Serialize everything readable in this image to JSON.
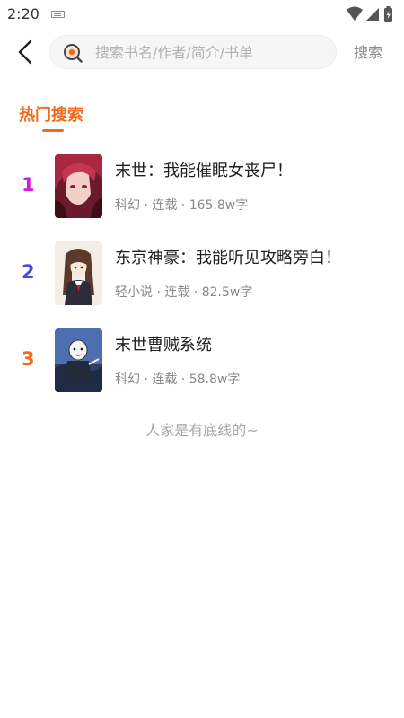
{
  "status_bar": {
    "time": "2:20",
    "icons": [
      "keyboard-icon",
      "wifi-icon",
      "signal-icon",
      "battery-charging-icon"
    ]
  },
  "search": {
    "placeholder": "搜索书名/作者/简介/书单",
    "value": "",
    "button_label": "搜索"
  },
  "hot_search": {
    "title": "热门搜索",
    "accent_color": "#f26b1d",
    "books": [
      {
        "rank": "1",
        "rank_color": "#d31ce0",
        "title": "末世：我能催眠女丧尸！",
        "meta": "科幻 · 连载 · 165.8w字"
      },
      {
        "rank": "2",
        "rank_color": "#4a4ad8",
        "title": "东京神豪：我能听见攻略旁白！",
        "meta": "轻小说 · 连载 · 82.5w字"
      },
      {
        "rank": "3",
        "rank_color": "#f26b1d",
        "title": "末世曹贼系统",
        "meta": "科幻 · 连载 · 58.8w字"
      }
    ]
  },
  "footer_tip": "人家是有底线的~"
}
